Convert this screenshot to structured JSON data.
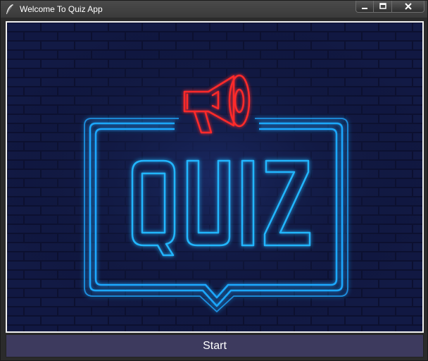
{
  "window": {
    "title": "Welcome To Quiz App"
  },
  "banner": {
    "logo_text": "QUIZ"
  },
  "actions": {
    "start_label": "Start"
  },
  "icons": {
    "app": "feather-icon",
    "megaphone": "megaphone-icon",
    "minimize": "minimize-icon",
    "maximize": "maximize-icon",
    "close": "close-icon"
  },
  "colors": {
    "neon_blue": "#1ea8ff",
    "neon_red": "#ff2a2a",
    "brick_bg": "#0d1233",
    "start_bg": "#3d3a5e"
  }
}
